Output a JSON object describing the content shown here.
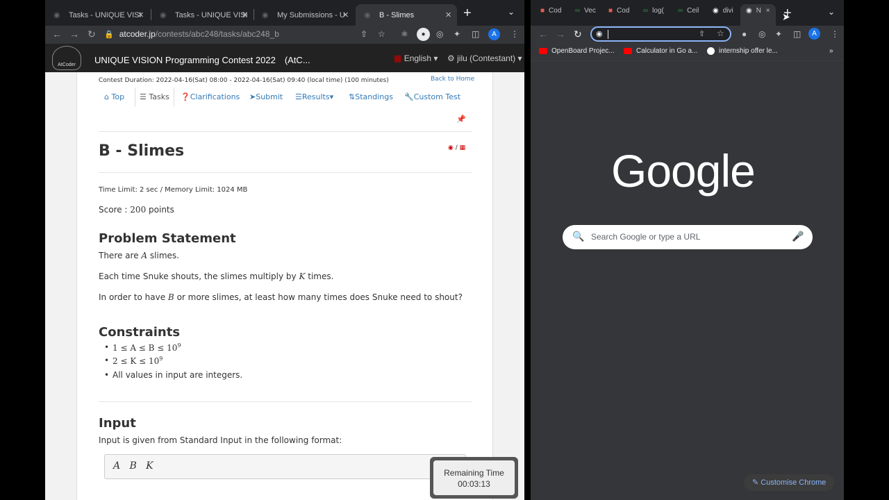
{
  "left_browser": {
    "tabs": [
      {
        "title": "Tasks - UNIQUE VISI"
      },
      {
        "title": "Tasks - UNIQUE VISI"
      },
      {
        "title": "My Submissions - U"
      },
      {
        "title": "B - Slimes"
      }
    ],
    "url_host": "atcoder.jp",
    "url_path": "/contests/abc248/tasks/abc248_b",
    "avatar_initial": "A"
  },
  "atcoder": {
    "logo_text": "AtCoder",
    "contest_name": "UNIQUE VISION Programming Contest 2022　(AtC...",
    "language": "English",
    "user": "jilu (Contestant)",
    "contest_duration": "Contest Duration: 2022-04-16(Sat) 08:00 - 2022-04-16(Sat) 09:40 (local time) (100 minutes)",
    "back_home": "Back to Home",
    "nav": {
      "top": "Top",
      "tasks": "Tasks",
      "clarifications": "Clarifications",
      "submit": "Submit",
      "results": "Results",
      "standings": "Standings",
      "custom_test": "Custom Test"
    },
    "task_title": "B - Slimes",
    "limits": "Time Limit: 2 sec / Memory Limit: 1024 MB",
    "score_label": "Score :",
    "score_value": "200",
    "score_unit": "points",
    "problem_heading": "Problem Statement",
    "statement": {
      "line1_pre": "There are",
      "line1_var": "A",
      "line1_post": "slimes.",
      "line2_pre": "Each time Snuke shouts, the slimes multiply by",
      "line2_var": "K",
      "line2_post": "times.",
      "line3_pre": "In order to have",
      "line3_var": "B",
      "line3_post": "or more slimes, at least how many times does Snuke need to shout?"
    },
    "constraints_heading": "Constraints",
    "constraints": {
      "c1": "1 ≤ A ≤ B ≤ 10",
      "c1_exp": "9",
      "c2": "2 ≤ K ≤ 10",
      "c2_exp": "9",
      "c3": "All values in input are integers."
    },
    "input_heading": "Input",
    "input_desc": "Input is given from Standard Input in the following format:",
    "input_format": "A   B   K"
  },
  "timer": {
    "label": "Remaining Time",
    "value": "00:03:13"
  },
  "right_browser": {
    "tabs": [
      {
        "title": "Cod"
      },
      {
        "title": "Vec"
      },
      {
        "title": "Cod"
      },
      {
        "title": "log("
      },
      {
        "title": "Ceil"
      },
      {
        "title": "divi"
      },
      {
        "title": "N"
      }
    ],
    "bookmarks": [
      {
        "title": "OpenBoard Projec..."
      },
      {
        "title": "Calculator in Go a..."
      },
      {
        "title": "internship offer le..."
      }
    ],
    "bookmarks_more": "»",
    "google_logo": "Google",
    "search_placeholder": "Search Google or type a URL",
    "customise": "Customise Chrome",
    "avatar_initial": "A"
  }
}
